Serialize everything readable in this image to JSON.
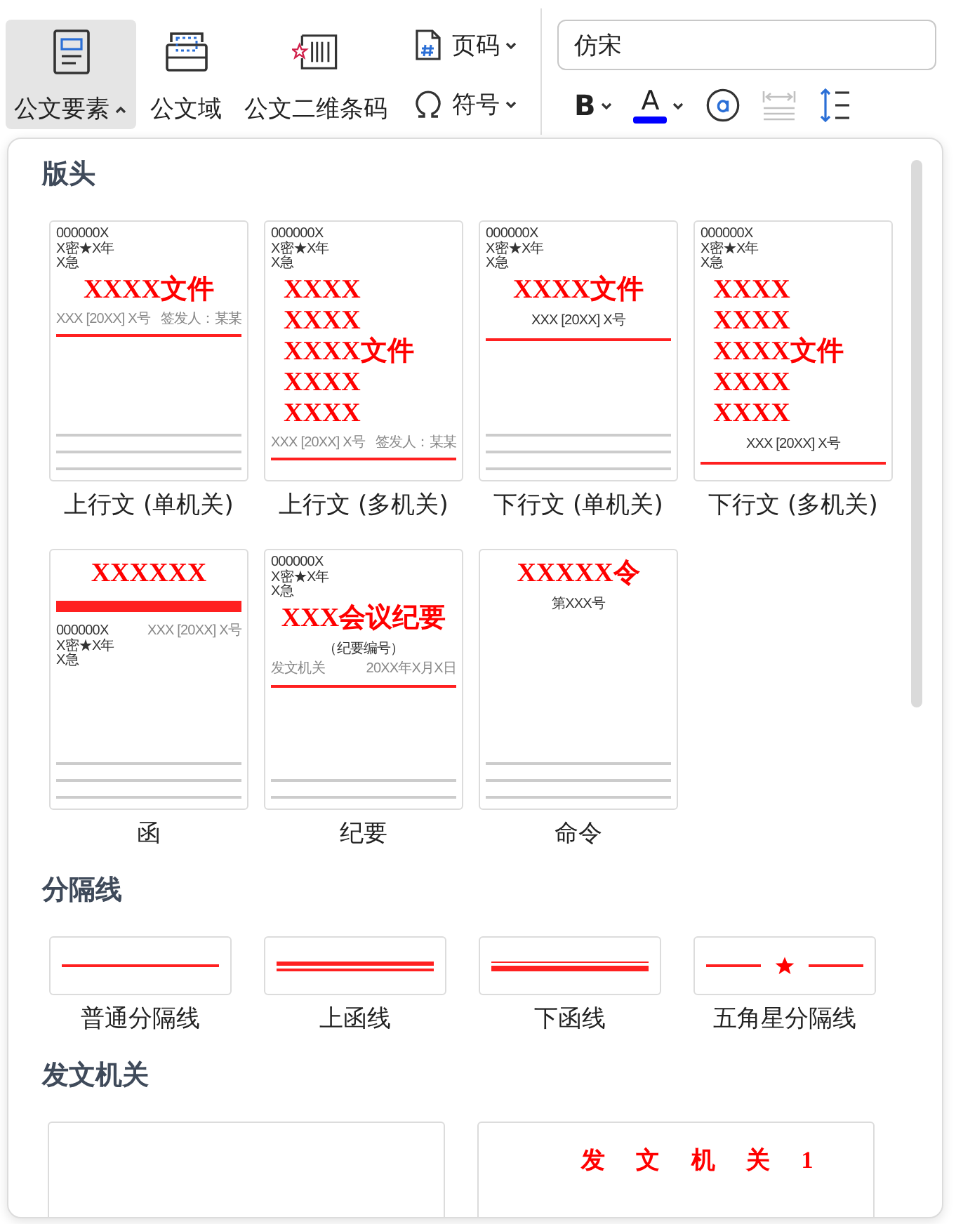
{
  "toolbar": {
    "large_buttons": [
      {
        "label": "公文要素",
        "kind": "dropdown",
        "selected": true,
        "expanded": true
      },
      {
        "label": "公文域",
        "kind": "plain",
        "selected": false
      },
      {
        "label": "公文二维条码",
        "kind": "plain",
        "selected": false
      }
    ],
    "small_buttons": [
      {
        "label": "页码",
        "expanded": false
      },
      {
        "label": "符号",
        "expanded": false
      }
    ],
    "font_field": {
      "value": "仿宋"
    },
    "format_buttons": [
      {
        "kind": "bold",
        "label": "B",
        "disabled": false
      },
      {
        "kind": "font_color",
        "label": "A",
        "color": "#0000ff",
        "disabled": false
      },
      {
        "kind": "circle_a",
        "disabled": false
      },
      {
        "kind": "char_spacing",
        "disabled": true
      },
      {
        "kind": "line_spacing",
        "disabled": false
      }
    ]
  },
  "panel": {
    "sections": [
      {
        "title": "版头",
        "kind": "templates",
        "items": [
          {
            "label": "上行文 (单机关)",
            "blocks": [
              {
                "kind": "meta",
                "lines": [
                  "000000X",
                  "X密★X年",
                  "X急"
                ]
              },
              {
                "kind": "title",
                "lines": [
                  "XXXX文件"
                ]
              },
              {
                "kind": "info",
                "left": "XXX [20XX] X号",
                "right": "签发人：某某"
              },
              {
                "kind": "rule"
              },
              {
                "kind": "gray_line"
              },
              {
                "kind": "gray_line"
              },
              {
                "kind": "gray_line"
              }
            ]
          },
          {
            "label": "上行文 (多机关)",
            "blocks": [
              {
                "kind": "meta",
                "lines": [
                  "000000X",
                  "X密★X年",
                  "X急"
                ]
              },
              {
                "kind": "stacked_title",
                "lines": [
                  "XXXX",
                  "XXXX",
                  "XXXX文件",
                  "XXXX",
                  "XXXX"
                ]
              },
              {
                "kind": "info",
                "left": "XXX [20XX] X号",
                "right": "签发人：某某"
              },
              {
                "kind": "rule"
              }
            ]
          },
          {
            "label": "下行文 (单机关)",
            "blocks": [
              {
                "kind": "meta",
                "lines": [
                  "000000X",
                  "X密★X年",
                  "X急"
                ]
              },
              {
                "kind": "title",
                "lines": [
                  "XXXX文件"
                ]
              },
              {
                "kind": "center_text",
                "text": "XXX [20XX] X号"
              },
              {
                "kind": "rule"
              },
              {
                "kind": "gray_line"
              },
              {
                "kind": "gray_line"
              },
              {
                "kind": "gray_line"
              }
            ]
          },
          {
            "label": "下行文 (多机关)",
            "blocks": [
              {
                "kind": "meta",
                "lines": [
                  "000000X",
                  "X密★X年",
                  "X急"
                ]
              },
              {
                "kind": "stacked_title",
                "lines": [
                  "XXXX",
                  "XXXX",
                  "XXXX文件",
                  "XXXX",
                  "XXXX"
                ]
              },
              {
                "kind": "center_text",
                "text": "XXX [20XX] X号"
              },
              {
                "kind": "rule"
              }
            ]
          },
          {
            "label": "函",
            "blocks": [
              {
                "kind": "title",
                "lines": [
                  "XXXXXX"
                ]
              },
              {
                "kind": "double_rule"
              },
              {
                "kind": "meta_info",
                "lines": [
                  "000000X",
                  "X密★X年",
                  "X急"
                ],
                "right": "XXX [20XX] X号"
              },
              {
                "kind": "gray_line"
              },
              {
                "kind": "gray_line"
              },
              {
                "kind": "gray_line"
              }
            ]
          },
          {
            "label": "纪要",
            "blocks": [
              {
                "kind": "meta",
                "lines": [
                  "000000X",
                  "X密★X年",
                  "X急"
                ]
              },
              {
                "kind": "title",
                "lines": [
                  "XXX会议纪要"
                ]
              },
              {
                "kind": "center_text",
                "text": "（纪要编号）"
              },
              {
                "kind": "info",
                "left": "发文机关",
                "right": "20XX年X月X日"
              },
              {
                "kind": "rule"
              },
              {
                "kind": "gray_line"
              },
              {
                "kind": "gray_line"
              }
            ]
          },
          {
            "label": "命令",
            "blocks": [
              {
                "kind": "title",
                "lines": [
                  "XXXXX令"
                ]
              },
              {
                "kind": "center_text",
                "text": "第XXX号"
              },
              {
                "kind": "gray_line"
              },
              {
                "kind": "gray_line"
              },
              {
                "kind": "gray_line"
              }
            ]
          }
        ]
      },
      {
        "title": "分隔线",
        "kind": "separators",
        "items": [
          {
            "label": "普通分隔线",
            "kind": "single"
          },
          {
            "label": "上函线",
            "kind": "thick_thin"
          },
          {
            "label": "下函线",
            "kind": "thin_thick"
          },
          {
            "label": "五角星分隔线",
            "kind": "star"
          }
        ]
      },
      {
        "title": "发文机关",
        "kind": "issuers",
        "items": [
          {
            "kind": "blank"
          },
          {
            "kind": "names",
            "lines": [
              "发 文 机 关 1"
            ]
          }
        ]
      }
    ]
  }
}
